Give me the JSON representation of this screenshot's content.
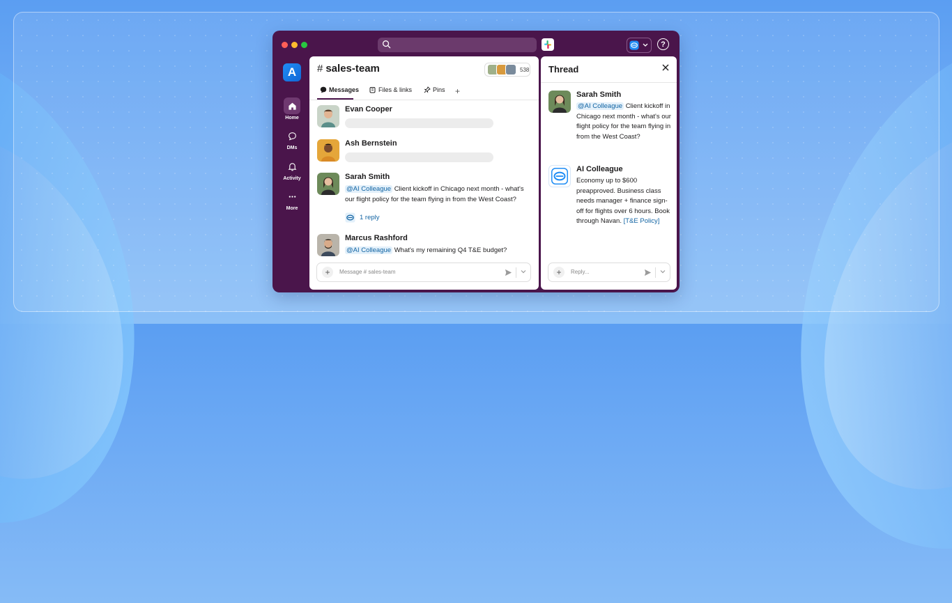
{
  "window": {
    "traffic_lights": [
      "#ff5f57",
      "#febc2e",
      "#28c840"
    ],
    "search_placeholder": ""
  },
  "sidebar": {
    "workspace_initial": "A",
    "items": [
      {
        "label": "Home",
        "icon": "home-icon",
        "active": true
      },
      {
        "label": "DMs",
        "icon": "chat-bubble-icon"
      },
      {
        "label": "Activity",
        "icon": "bell-icon"
      },
      {
        "label": "More",
        "icon": "more-dots-icon"
      }
    ]
  },
  "channel": {
    "name": "sales-team",
    "member_count": "538",
    "tabs": [
      {
        "label": "Messages",
        "icon": "message-icon"
      },
      {
        "label": "Files & links",
        "icon": "files-icon"
      },
      {
        "label": "Pins",
        "icon": "pin-icon"
      }
    ],
    "messages": [
      {
        "author": "Evan Cooper"
      },
      {
        "author": "Ash Bernstein"
      },
      {
        "author": "Sarah Smith",
        "mention": "@AI Colleague",
        "text": "Client kickoff in Chicago next month - what's our flight policy for the team flying in from the West Coast?",
        "reply_count": "1 reply"
      },
      {
        "author": "Marcus Rashford",
        "mention": "@AI Colleague",
        "text": "What's my remaining Q4 T&E budget?"
      }
    ],
    "composer_placeholder": "Message # sales-team"
  },
  "thread": {
    "title": "Thread",
    "messages": [
      {
        "author": "Sarah Smith",
        "mention": "@AI Colleague",
        "text": "Client kickoff in Chicago next month - what's our flight policy for the team flying in from the West Coast?"
      },
      {
        "author": "AI Colleague",
        "text": "Economy up to $600 preapproved. Business class needs manager + finance sign-off for flights over 6 hours. Book through Navan.",
        "link": "[T&E Policy]"
      }
    ],
    "composer_placeholder": "Reply..."
  },
  "colors": {
    "sidebar": "#4a154b",
    "mention_bg": "#e3f0fa",
    "link": "#1264a3",
    "workspace": "#1f8df5"
  }
}
